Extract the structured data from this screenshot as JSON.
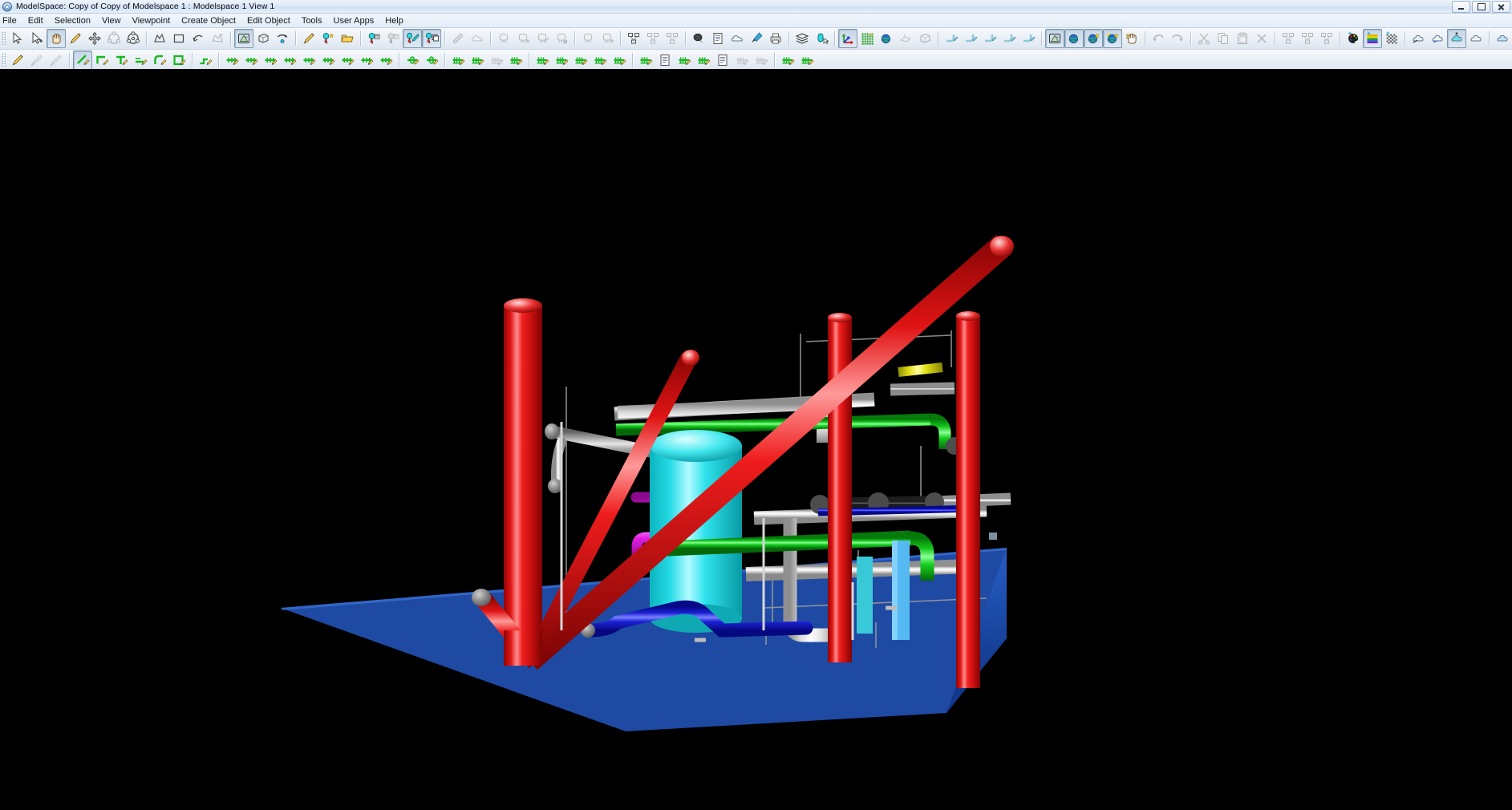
{
  "window": {
    "title": "ModelSpace: Copy of Copy of Modelspace 1 : Modelspace 1 View 1",
    "app_icon": "modelspace-app-icon",
    "controls": {
      "minimize": "Minimize",
      "maximize": "Maximize",
      "close": "Close"
    }
  },
  "menubar": {
    "items": [
      {
        "label": "File"
      },
      {
        "label": "Edit"
      },
      {
        "label": "Selection"
      },
      {
        "label": "View"
      },
      {
        "label": "Viewpoint"
      },
      {
        "label": "Create Object"
      },
      {
        "label": "Edit Object"
      },
      {
        "label": "Tools"
      },
      {
        "label": "User Apps"
      },
      {
        "label": "Help"
      }
    ]
  },
  "toolbars": {
    "row1": [
      {
        "group": "selection",
        "buttons": [
          {
            "icon": "select-arrow-icon",
            "state": "normal"
          },
          {
            "icon": "select-add-arrow-icon",
            "state": "normal"
          },
          {
            "icon": "pan-hand-icon",
            "state": "pressed"
          },
          {
            "icon": "pencil-icon",
            "state": "normal"
          },
          {
            "icon": "move-4way-icon",
            "state": "normal"
          },
          {
            "icon": "orbit-wheel-icon",
            "state": "disabled"
          },
          {
            "icon": "rotate-globe-icon",
            "state": "normal"
          }
        ]
      },
      {
        "group": "zoom",
        "buttons": [
          {
            "icon": "zoom-area-icon",
            "state": "normal"
          },
          {
            "icon": "zoom-window-icon",
            "state": "normal"
          },
          {
            "icon": "zoom-previous-icon",
            "state": "normal"
          },
          {
            "icon": "zoom-extents-icon",
            "state": "disabled"
          }
        ]
      },
      {
        "group": "view-modes",
        "buttons": [
          {
            "icon": "shaded-view-icon",
            "state": "pressed"
          },
          {
            "icon": "wireframe-box-icon",
            "state": "normal"
          },
          {
            "icon": "view-rotate-icon",
            "state": "normal"
          }
        ]
      },
      {
        "group": "markup",
        "buttons": [
          {
            "icon": "highlight-pen-icon",
            "state": "normal"
          },
          {
            "icon": "pin-star-icon",
            "state": "normal"
          },
          {
            "icon": "open-folder-icon",
            "state": "normal"
          }
        ]
      },
      {
        "group": "tags",
        "buttons": [
          {
            "icon": "tag-place-icon",
            "state": "normal"
          },
          {
            "icon": "tag-place-alt-icon",
            "state": "disabled"
          },
          {
            "icon": "tag-edit-icon",
            "state": "pressed"
          },
          {
            "icon": "tag-copy-icon",
            "state": "pressed"
          }
        ]
      },
      {
        "group": "measure",
        "buttons": [
          {
            "icon": "measure-ruler-icon",
            "state": "disabled"
          },
          {
            "icon": "cloud-measure-icon",
            "state": "disabled"
          }
        ]
      },
      {
        "group": "equipment",
        "buttons": [
          {
            "icon": "equipment-icon",
            "state": "disabled"
          },
          {
            "icon": "equipment-add-icon",
            "state": "disabled"
          },
          {
            "icon": "equipment-edit-icon",
            "state": "disabled"
          },
          {
            "icon": "equipment-delete-icon",
            "state": "disabled"
          }
        ]
      },
      {
        "group": "nozzle",
        "buttons": [
          {
            "icon": "nozzle-icon",
            "state": "disabled"
          },
          {
            "icon": "nozzle-add-icon",
            "state": "disabled"
          }
        ]
      },
      {
        "group": "structure",
        "buttons": [
          {
            "icon": "structure-edit-icon",
            "state": "normal"
          },
          {
            "icon": "structure-copy-icon",
            "state": "disabled"
          },
          {
            "icon": "structure-delete-icon",
            "state": "disabled"
          }
        ]
      },
      {
        "group": "annotation",
        "buttons": [
          {
            "icon": "balloon-icon",
            "state": "normal"
          },
          {
            "icon": "report-icon",
            "state": "normal"
          },
          {
            "icon": "cloud-icon",
            "state": "normal"
          },
          {
            "icon": "paintbrush-icon",
            "state": "normal"
          },
          {
            "icon": "print-preview-icon",
            "state": "normal"
          }
        ]
      },
      {
        "group": "layers",
        "buttons": [
          {
            "icon": "layers-icon",
            "state": "normal"
          },
          {
            "icon": "layer-select-icon",
            "state": "normal"
          }
        ]
      },
      {
        "group": "coordinates",
        "buttons": [
          {
            "icon": "axis-triad-icon",
            "state": "pressed"
          },
          {
            "icon": "grid-icon",
            "state": "normal"
          },
          {
            "icon": "north-globe-icon",
            "state": "normal"
          },
          {
            "icon": "clip-plane-icon",
            "state": "disabled"
          },
          {
            "icon": "clip-box-icon",
            "state": "disabled"
          }
        ]
      },
      {
        "group": "pipe-tools",
        "buttons": [
          {
            "icon": "pipe-route-icon",
            "state": "normal"
          },
          {
            "icon": "pipe-branch-icon",
            "state": "normal"
          },
          {
            "icon": "pipe-split-icon",
            "state": "normal"
          },
          {
            "icon": "pipe-join-icon",
            "state": "normal"
          },
          {
            "icon": "pipe-trim-icon",
            "state": "normal"
          }
        ]
      },
      {
        "group": "render",
        "buttons": [
          {
            "icon": "render-shade-icon",
            "state": "pressed"
          },
          {
            "icon": "render-globe-icon",
            "state": "pressed"
          },
          {
            "icon": "render-globe-star-icon",
            "state": "pressed"
          },
          {
            "icon": "render-globe-sun-icon",
            "state": "pressed"
          },
          {
            "icon": "pick-hand-icon",
            "state": "normal"
          }
        ]
      },
      {
        "group": "undo",
        "buttons": [
          {
            "icon": "undo-icon",
            "state": "disabled"
          },
          {
            "icon": "redo-icon",
            "state": "disabled"
          }
        ]
      },
      {
        "group": "clipboard",
        "buttons": [
          {
            "icon": "cut-icon",
            "state": "disabled"
          },
          {
            "icon": "copy-icon",
            "state": "disabled"
          },
          {
            "icon": "paste-icon",
            "state": "disabled"
          },
          {
            "icon": "delete-icon",
            "state": "disabled"
          }
        ]
      },
      {
        "group": "align",
        "buttons": [
          {
            "icon": "align-group-icon",
            "state": "disabled"
          },
          {
            "icon": "align-distribute-icon",
            "state": "disabled"
          },
          {
            "icon": "align-array-icon",
            "state": "disabled"
          }
        ]
      },
      {
        "group": "color",
        "buttons": [
          {
            "icon": "color-palette-icon",
            "state": "normal"
          },
          {
            "icon": "color-spectrum-icon",
            "state": "pressed"
          },
          {
            "icon": "color-pattern-icon",
            "state": "normal"
          }
        ]
      },
      {
        "group": "display",
        "buttons": [
          {
            "icon": "display-hide-icon",
            "state": "normal"
          },
          {
            "icon": "display-show-icon",
            "state": "normal"
          },
          {
            "icon": "display-isolate-icon",
            "state": "pressed"
          },
          {
            "icon": "display-all-icon",
            "state": "normal"
          }
        ]
      },
      {
        "group": "transparency",
        "buttons": [
          {
            "icon": "transparency-icon",
            "state": "normal"
          }
        ]
      },
      {
        "group": "grid-display",
        "buttons": [
          {
            "icon": "grid-dense-icon",
            "state": "normal"
          },
          {
            "icon": "grid-sparse-icon",
            "state": "disabled"
          }
        ]
      },
      {
        "group": "misc",
        "buttons": [
          {
            "icon": "cloud-marker-icon",
            "state": "normal"
          },
          {
            "icon": "settings-gear-icon",
            "state": "normal"
          }
        ]
      }
    ],
    "row2": [
      {
        "group": "line-tools",
        "buttons": [
          {
            "icon": "draw-line-icon",
            "state": "normal"
          },
          {
            "icon": "draw-line-alt-icon",
            "state": "disabled"
          },
          {
            "icon": "draw-line-free-icon",
            "state": "disabled"
          }
        ]
      },
      {
        "group": "pipe-create",
        "buttons": [
          {
            "icon": "pipe-new-icon",
            "state": "pressed"
          },
          {
            "icon": "pipe-elbow-icon",
            "state": "normal"
          },
          {
            "icon": "pipe-tee-icon",
            "state": "normal"
          },
          {
            "icon": "pipe-reducer-icon",
            "state": "normal"
          },
          {
            "icon": "pipe-bend-icon",
            "state": "normal"
          },
          {
            "icon": "pipe-square-icon",
            "state": "normal"
          }
        ]
      },
      {
        "group": "pipe-modify",
        "buttons": [
          {
            "icon": "pipe-slope-icon",
            "state": "normal"
          }
        ]
      },
      {
        "group": "valve",
        "buttons": [
          {
            "icon": "valve-gate-icon",
            "state": "normal"
          },
          {
            "icon": "valve-globe-icon",
            "state": "normal"
          },
          {
            "icon": "valve-check-icon",
            "state": "normal"
          },
          {
            "icon": "valve-ball-icon",
            "state": "normal"
          },
          {
            "icon": "valve-butterfly-icon",
            "state": "normal"
          },
          {
            "icon": "valve-relief-icon",
            "state": "normal"
          },
          {
            "icon": "valve-control-icon",
            "state": "normal"
          },
          {
            "icon": "valve-plug-icon",
            "state": "normal"
          },
          {
            "icon": "valve-needle-icon",
            "state": "normal"
          }
        ]
      },
      {
        "group": "fitting",
        "buttons": [
          {
            "icon": "fitting-flange-icon",
            "state": "normal"
          },
          {
            "icon": "fitting-coupling-icon",
            "state": "normal"
          }
        ]
      },
      {
        "group": "support",
        "buttons": [
          {
            "icon": "support-hanger-icon",
            "state": "normal"
          },
          {
            "icon": "support-shoe-icon",
            "state": "normal"
          },
          {
            "icon": "support-guide-icon",
            "state": "disabled"
          },
          {
            "icon": "support-anchor-icon",
            "state": "normal"
          }
        ]
      },
      {
        "group": "instrument",
        "buttons": [
          {
            "icon": "instrument-gauge-icon",
            "state": "normal"
          },
          {
            "icon": "instrument-flow-icon",
            "state": "normal"
          },
          {
            "icon": "instrument-level-icon",
            "state": "normal"
          },
          {
            "icon": "instrument-temp-icon",
            "state": "normal"
          },
          {
            "icon": "instrument-press-icon",
            "state": "normal"
          }
        ]
      },
      {
        "group": "spec",
        "buttons": [
          {
            "icon": "spec-check-icon",
            "state": "normal"
          },
          {
            "icon": "spec-list-icon",
            "state": "normal"
          },
          {
            "icon": "spec-edit-icon",
            "state": "normal"
          },
          {
            "icon": "spec-apply-icon",
            "state": "normal"
          },
          {
            "icon": "spec-report-icon",
            "state": "normal"
          },
          {
            "icon": "spec-grey-icon",
            "state": "disabled"
          },
          {
            "icon": "spec-grey-alt-icon",
            "state": "disabled"
          }
        ]
      },
      {
        "group": "isometric",
        "buttons": [
          {
            "icon": "iso-extract-icon",
            "state": "normal"
          },
          {
            "icon": "iso-settings-icon",
            "state": "normal"
          }
        ]
      }
    ]
  },
  "viewport": {
    "name": "modelspace-3d-viewport",
    "background_color": "#000000",
    "model": {
      "description": "3D piping and structural plant model",
      "ground_plate_color": "#1f4aa8",
      "elements": [
        {
          "name": "structural-column-left",
          "color": "#ee1111",
          "type": "vertical-column"
        },
        {
          "name": "structural-column-mid",
          "color": "#ee1111",
          "type": "vertical-column"
        },
        {
          "name": "structural-column-right",
          "color": "#ee1111",
          "type": "vertical-column"
        },
        {
          "name": "diagonal-brace-main",
          "color": "#dd1111",
          "type": "diagonal-brace"
        },
        {
          "name": "diagonal-brace-lower",
          "color": "#dd1111",
          "type": "diagonal-brace"
        },
        {
          "name": "diagonal-brace-upper",
          "color": "#dd1111",
          "type": "diagonal-brace"
        },
        {
          "name": "vessel-cylindrical",
          "color": "#22e0e8",
          "type": "vessel"
        },
        {
          "name": "pipe-header-white-upper",
          "color": "#f2f2f2",
          "type": "pipe"
        },
        {
          "name": "pipe-header-white-lower",
          "color": "#f2f2f2",
          "type": "pipe"
        },
        {
          "name": "pipe-green-upper",
          "color": "#15dd22",
          "type": "pipe"
        },
        {
          "name": "pipe-green-lower",
          "color": "#15dd22",
          "type": "pipe"
        },
        {
          "name": "pipe-blue-base",
          "color": "#1a1fcf",
          "type": "pipe"
        },
        {
          "name": "pipe-magenta-branch",
          "color": "#ee22ee",
          "type": "pipe"
        },
        {
          "name": "pipe-yellow-riser",
          "color": "#eded22",
          "type": "pipe"
        },
        {
          "name": "pipe-grey-branch",
          "color": "#b0b0b0",
          "type": "pipe"
        },
        {
          "name": "valve-dark-grey-cluster",
          "color": "#505050",
          "type": "valve"
        },
        {
          "name": "ground-plate",
          "color": "#1f4aa8",
          "type": "base-plate"
        }
      ]
    }
  }
}
